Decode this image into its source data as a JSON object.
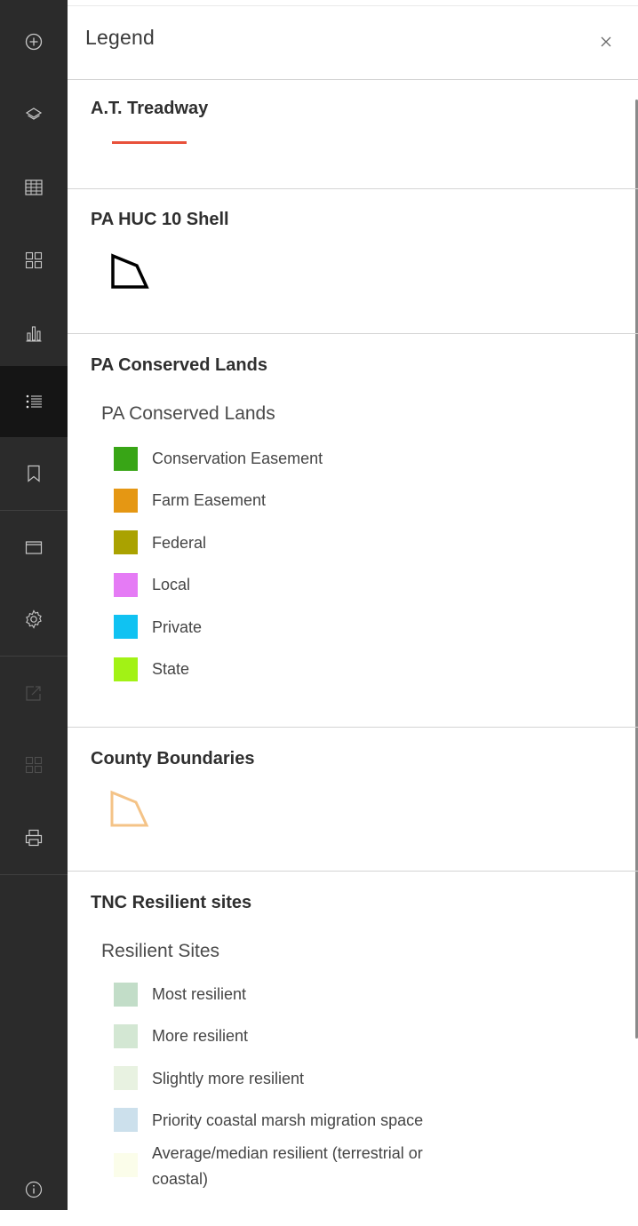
{
  "toolbar": {
    "items": [
      {
        "name": "add-icon",
        "enabled": true
      },
      {
        "name": "layers-icon",
        "enabled": true
      },
      {
        "name": "table-icon",
        "enabled": true
      },
      {
        "name": "basemap-gallery-icon",
        "enabled": true
      },
      {
        "name": "chart-icon",
        "enabled": true
      },
      {
        "name": "legend-icon",
        "enabled": true,
        "active": true
      },
      {
        "name": "bookmark-icon",
        "enabled": true
      },
      {
        "name": "folder-icon",
        "enabled": true
      },
      {
        "name": "gear-icon",
        "enabled": true
      },
      {
        "name": "share-icon",
        "enabled": false
      },
      {
        "name": "grid-icon",
        "enabled": false
      },
      {
        "name": "print-icon",
        "enabled": true
      },
      {
        "name": "info-icon",
        "enabled": true
      }
    ]
  },
  "panel": {
    "title": "Legend",
    "close_icon": "close-icon"
  },
  "legend": {
    "at_treadway": {
      "title": "A.T. Treadway",
      "line_color": "#e8513a"
    },
    "huc10": {
      "title": "PA HUC 10 Shell",
      "outline_color": "#000000"
    },
    "conserved": {
      "title": "PA Conserved Lands",
      "subtitle": "PA Conserved Lands",
      "items": [
        {
          "label": "Conservation Easement",
          "color": "#38a516"
        },
        {
          "label": "Farm Easement",
          "color": "#e59713"
        },
        {
          "label": "Federal",
          "color": "#aaa200"
        },
        {
          "label": "Local",
          "color": "#e57bf5"
        },
        {
          "label": "Private",
          "color": "#10c2f2"
        },
        {
          "label": "State",
          "color": "#a2f215"
        }
      ]
    },
    "county": {
      "title": "County Boundaries",
      "outline_color": "#f4c387"
    },
    "tnc": {
      "title": "TNC Resilient sites",
      "subtitle": "Resilient Sites",
      "items": [
        {
          "label": "Most resilient",
          "color": "#c2ddc8"
        },
        {
          "label": "More resilient",
          "color": "#d3e7d3"
        },
        {
          "label": "Slightly more resilient",
          "color": "#e8f2e1"
        },
        {
          "label": "Priority coastal marsh migration space",
          "color": "#cce0ec"
        },
        {
          "label": "Average/median resilient (terrestrial or",
          "label2": "coastal)",
          "color": "#fbfdea"
        }
      ]
    }
  }
}
